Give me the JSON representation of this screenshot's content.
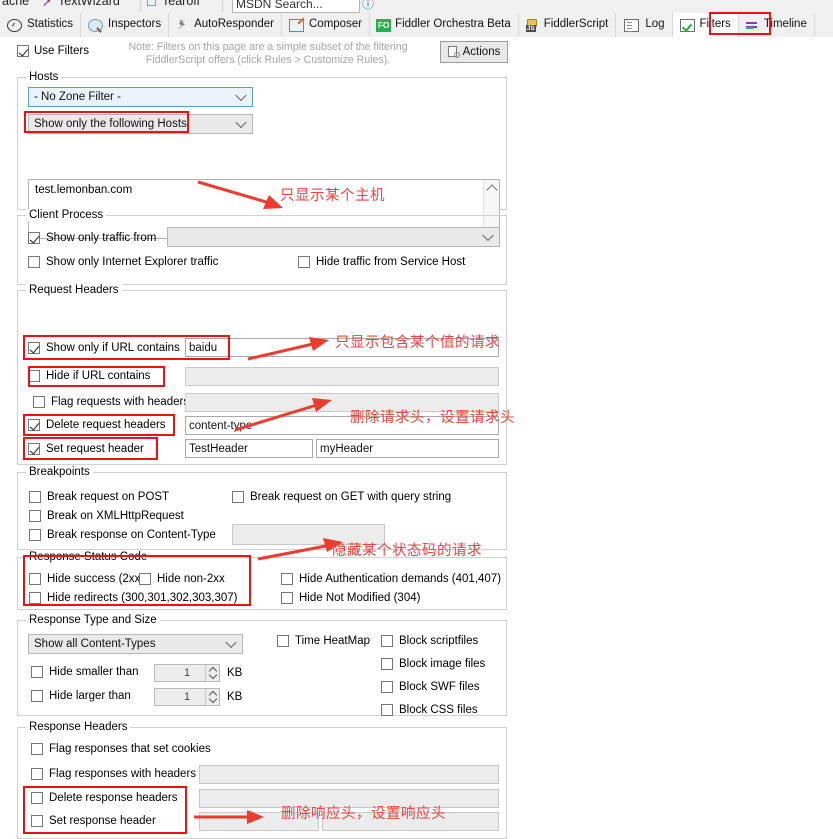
{
  "toolstrip": {
    "items": [
      {
        "label": "ache",
        "icon": "cache-icon"
      },
      {
        "label": "TextWizard",
        "icon": "textwizard-icon"
      },
      {
        "label": "Tearoff",
        "icon": "tearoff-icon"
      },
      {
        "label": "MSDN Search...",
        "icon": "search-box"
      },
      {
        "label": "",
        "icon": "help-icon"
      }
    ]
  },
  "tabs": [
    {
      "label": "Statistics",
      "icon": "statistics-icon",
      "active": false
    },
    {
      "label": "Inspectors",
      "icon": "inspectors-icon",
      "active": false
    },
    {
      "label": "AutoResponder",
      "icon": "autoresponder-icon",
      "active": false
    },
    {
      "label": "Composer",
      "icon": "composer-icon",
      "active": false
    },
    {
      "label": "Fiddler Orchestra Beta",
      "icon": "fiddler-orchestra-icon",
      "active": false
    },
    {
      "label": "FiddlerScript",
      "icon": "fiddlerscript-icon",
      "active": false
    },
    {
      "label": "Log",
      "icon": "log-icon",
      "active": false
    },
    {
      "label": "Filters",
      "icon": "filters-icon",
      "active": true
    },
    {
      "label": "Timeline",
      "icon": "timeline-icon",
      "active": false
    }
  ],
  "header": {
    "use_filters_label": "Use Filters",
    "use_filters_checked": true,
    "note_line1": "Note: Filters on this page are a simple subset of the filtering",
    "note_line2": "FiddlerScript offers (click Rules > Customize Rules).",
    "actions_label": "Actions"
  },
  "hosts": {
    "caption": "Hosts",
    "zone_filter_value": "- No Zone Filter -",
    "host_filter_value": "Show only the following Hosts",
    "host_list_value": "test.lemonban.com"
  },
  "client_process": {
    "caption": "Client Process",
    "show_only_traffic_from_label": "Show only traffic from",
    "show_only_traffic_from_checked": true,
    "process_value": "",
    "show_only_ie_label": "Show only Internet Explorer traffic",
    "show_only_ie_checked": false,
    "hide_service_host_label": "Hide traffic from Service Host",
    "hide_service_host_checked": false
  },
  "request_headers": {
    "caption": "Request Headers",
    "show_only_url_label": "Show only if URL contains",
    "show_only_url_checked": true,
    "show_only_url_value": "baidu",
    "hide_url_label": "Hide if URL contains",
    "hide_url_checked": false,
    "hide_url_value": "",
    "flag_requests_label": "Flag requests with headers",
    "flag_requests_checked": false,
    "flag_requests_value": "",
    "delete_headers_label": "Delete request headers",
    "delete_headers_checked": true,
    "delete_headers_value": "content-type",
    "set_header_label": "Set request header",
    "set_header_checked": true,
    "set_header_name": "TestHeader",
    "set_header_value": "myHeader"
  },
  "breakpoints": {
    "caption": "Breakpoints",
    "break_post_label": "Break request on POST",
    "break_post_checked": false,
    "break_get_label": "Break request on GET with query string",
    "break_get_checked": false,
    "break_xhr_label": "Break on XMLHttpRequest",
    "break_xhr_checked": false,
    "break_response_label": "Break response on Content-Type",
    "break_response_checked": false,
    "break_response_value": ""
  },
  "response_status": {
    "caption": "Response Status Code",
    "hide_success_label": "Hide success (2xx)",
    "hide_success_checked": false,
    "hide_non2xx_label": "Hide non-2xx",
    "hide_non2xx_checked": false,
    "hide_auth_label": "Hide Authentication demands (401,407)",
    "hide_auth_checked": false,
    "hide_redirects_label": "Hide redirects (300,301,302,303,307)",
    "hide_redirects_checked": false,
    "hide_not_modified_label": "Hide Not Modified (304)",
    "hide_not_modified_checked": false
  },
  "response_type": {
    "caption": "Response Type and Size",
    "content_types_value": "Show all Content-Types",
    "hide_smaller_label": "Hide smaller than",
    "hide_smaller_checked": false,
    "hide_smaller_value": "1",
    "hide_smaller_unit": "KB",
    "hide_larger_label": "Hide larger than",
    "hide_larger_checked": false,
    "hide_larger_value": "1",
    "hide_larger_unit": "KB",
    "time_heatmap_label": "Time HeatMap",
    "time_heatmap_checked": false,
    "block_script_label": "Block scriptfiles",
    "block_script_checked": false,
    "block_image_label": "Block image files",
    "block_image_checked": false,
    "block_swf_label": "Block SWF files",
    "block_swf_checked": false,
    "block_css_label": "Block CSS files",
    "block_css_checked": false
  },
  "response_headers": {
    "caption": "Response Headers",
    "flag_cookies_label": "Flag responses that set cookies",
    "flag_cookies_checked": false,
    "flag_headers_label": "Flag responses with headers",
    "flag_headers_checked": false,
    "flag_headers_value": "",
    "delete_headers_label": "Delete response headers",
    "delete_headers_checked": false,
    "delete_headers_value": "",
    "set_header_label": "Set response header",
    "set_header_checked": false,
    "set_header_name": "",
    "set_header_value": ""
  },
  "annotations": {
    "colors": {
      "red": "#ee1111",
      "red_text": "#f4413f"
    },
    "host_note": "只显示某个主机",
    "url_note": "只显示包含某个值的请求",
    "request_header_note": "删除请求头，设置请求头",
    "status_code_note": "隐藏某个状态码的请求",
    "response_header_note": "删除响应头，设置响应头"
  }
}
